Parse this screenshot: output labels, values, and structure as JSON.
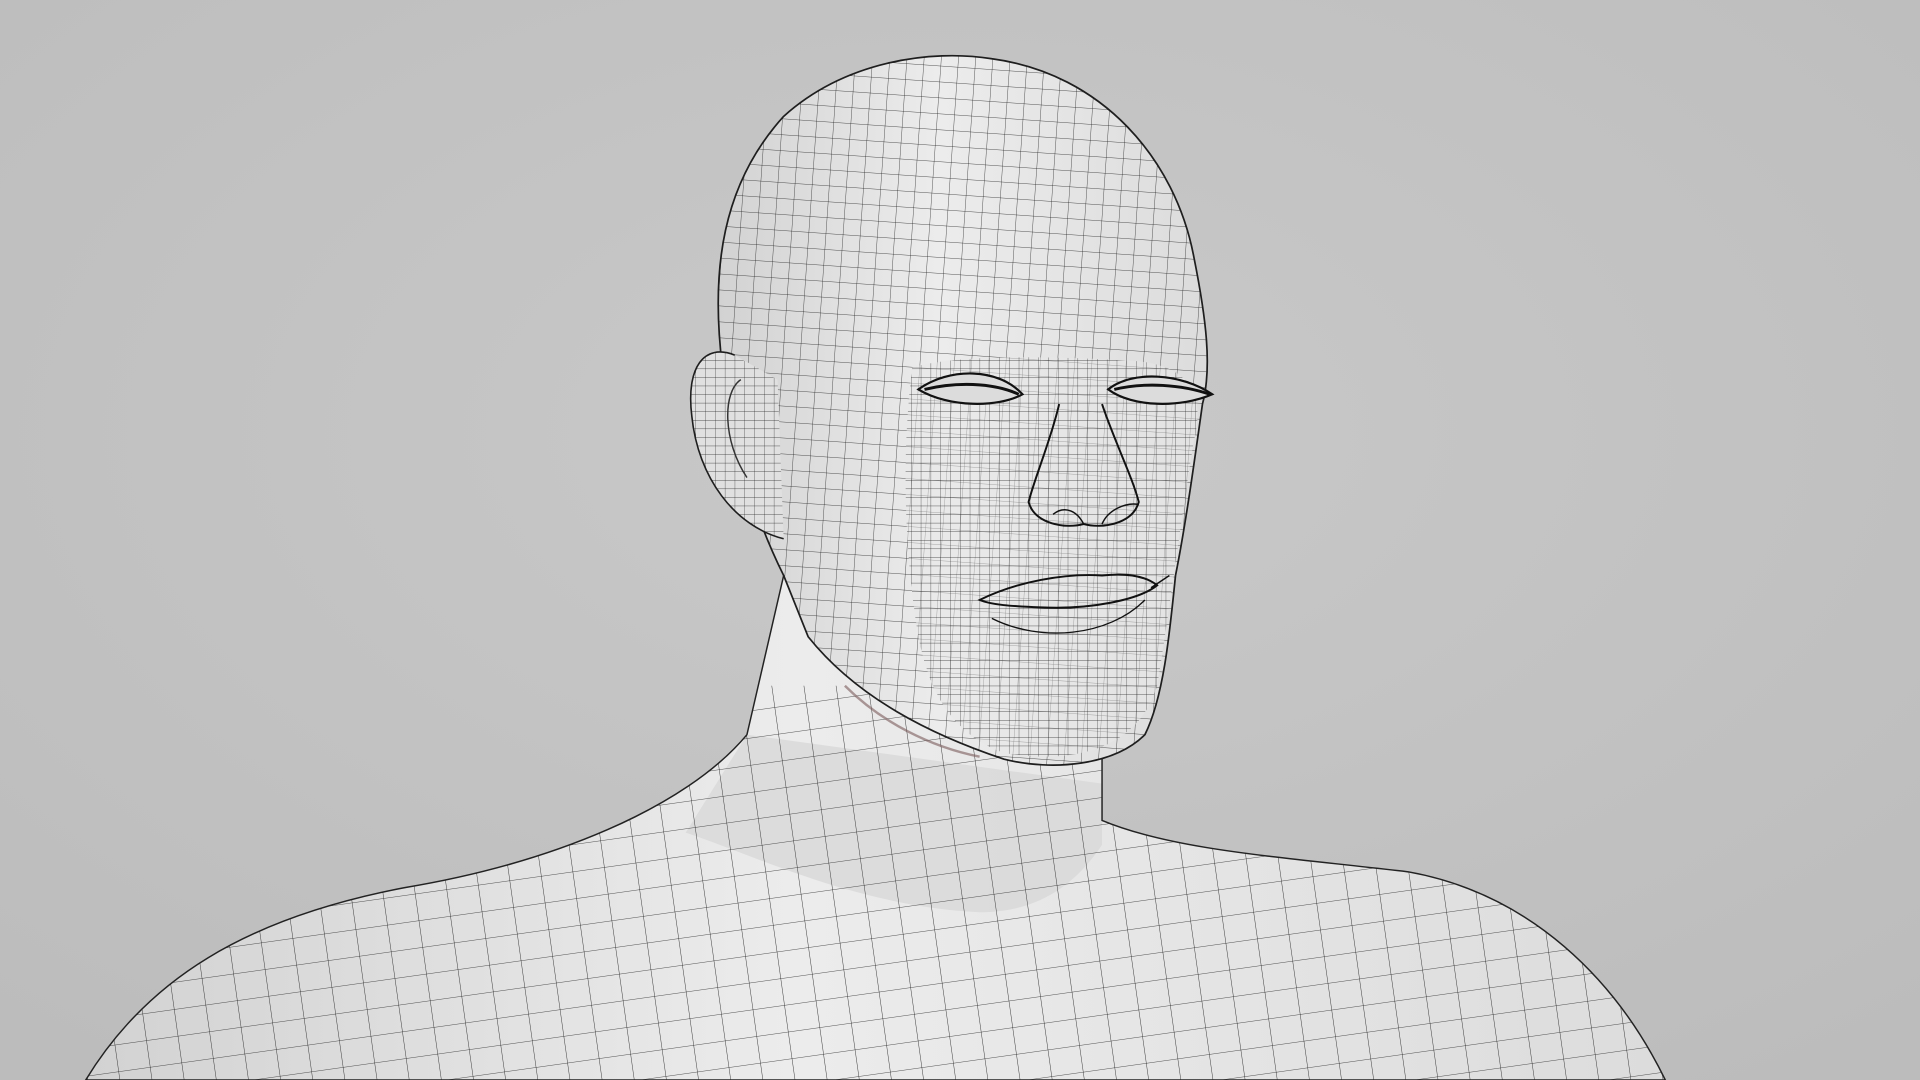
{
  "scene": {
    "subject": "wireframe-human-head-bust",
    "colors": {
      "background": "#c3c3c3",
      "mesh_fill": "#e4e4e4",
      "mesh_shadow": "#cfcfcf",
      "wire": "#1e1e1e"
    }
  }
}
